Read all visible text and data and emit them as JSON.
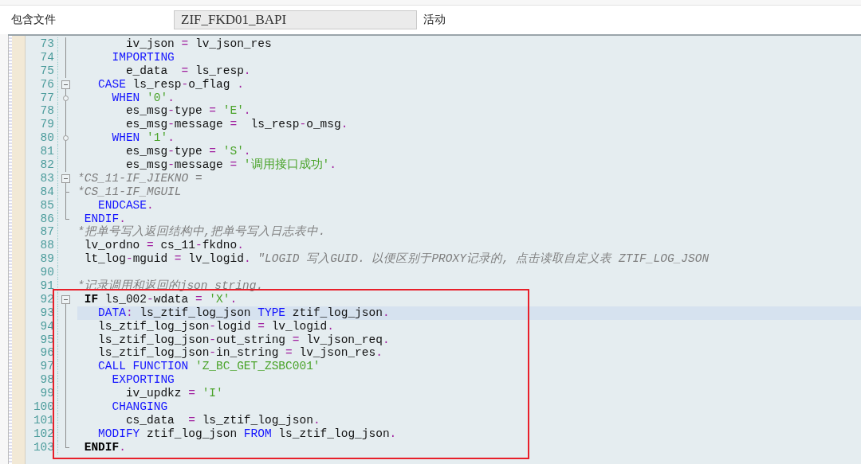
{
  "header": {
    "label": "包含文件",
    "field_value": "ZIF_FKD01_BAPI",
    "status": "活动"
  },
  "lines": [
    {
      "no": "73",
      "kind": "line",
      "current": false,
      "tokens": [
        {
          "kind": "id",
          "text": "       iv_json "
        },
        {
          "kind": "op",
          "text": "="
        },
        {
          "kind": "id",
          "text": " lv_json_res"
        }
      ]
    },
    {
      "no": "74",
      "kind": "line",
      "current": false,
      "tokens": [
        {
          "kind": "kw",
          "text": "     IMPORTING"
        }
      ]
    },
    {
      "no": "75",
      "kind": "line",
      "current": false,
      "tokens": [
        {
          "kind": "id",
          "text": "       e_data  "
        },
        {
          "kind": "op",
          "text": "="
        },
        {
          "kind": "id",
          "text": " ls_resp"
        },
        {
          "kind": "op",
          "text": "."
        }
      ]
    },
    {
      "no": "76",
      "kind": "open",
      "current": false,
      "tokens": [
        {
          "kind": "kw",
          "text": "   CASE"
        },
        {
          "kind": "id",
          "text": " ls_resp"
        },
        {
          "kind": "op",
          "text": "-"
        },
        {
          "kind": "id",
          "text": "o_flag "
        },
        {
          "kind": "op",
          "text": "."
        }
      ]
    },
    {
      "no": "77",
      "kind": "branch",
      "current": false,
      "tokens": [
        {
          "kind": "kw",
          "text": "     WHEN"
        },
        {
          "kind": "str",
          "text": " '0'"
        },
        {
          "kind": "op",
          "text": "."
        }
      ]
    },
    {
      "no": "78",
      "kind": "line",
      "current": false,
      "tokens": [
        {
          "kind": "id",
          "text": "       es_msg"
        },
        {
          "kind": "op",
          "text": "-"
        },
        {
          "kind": "id",
          "text": "type "
        },
        {
          "kind": "op",
          "text": "="
        },
        {
          "kind": "str",
          "text": " 'E'"
        },
        {
          "kind": "op",
          "text": "."
        }
      ]
    },
    {
      "no": "79",
      "kind": "line",
      "current": false,
      "tokens": [
        {
          "kind": "id",
          "text": "       es_msg"
        },
        {
          "kind": "op",
          "text": "-"
        },
        {
          "kind": "id",
          "text": "message "
        },
        {
          "kind": "op",
          "text": "="
        },
        {
          "kind": "id",
          "text": "  ls_resp"
        },
        {
          "kind": "op",
          "text": "-"
        },
        {
          "kind": "id",
          "text": "o_msg"
        },
        {
          "kind": "op",
          "text": "."
        }
      ]
    },
    {
      "no": "80",
      "kind": "branch",
      "current": false,
      "tokens": [
        {
          "kind": "kw",
          "text": "     WHEN"
        },
        {
          "kind": "str",
          "text": " '1'"
        },
        {
          "kind": "op",
          "text": "."
        }
      ]
    },
    {
      "no": "81",
      "kind": "line",
      "current": false,
      "tokens": [
        {
          "kind": "id",
          "text": "       es_msg"
        },
        {
          "kind": "op",
          "text": "-"
        },
        {
          "kind": "id",
          "text": "type "
        },
        {
          "kind": "op",
          "text": "="
        },
        {
          "kind": "str",
          "text": " 'S'"
        },
        {
          "kind": "op",
          "text": "."
        }
      ]
    },
    {
      "no": "82",
      "kind": "line",
      "current": false,
      "tokens": [
        {
          "kind": "id",
          "text": "       es_msg"
        },
        {
          "kind": "op",
          "text": "-"
        },
        {
          "kind": "id",
          "text": "message "
        },
        {
          "kind": "op",
          "text": "="
        },
        {
          "kind": "str",
          "text": " '调用接口成功'"
        },
        {
          "kind": "op",
          "text": "."
        }
      ]
    },
    {
      "no": "83",
      "kind": "open",
      "current": false,
      "tokens": [
        {
          "kind": "cmt",
          "text": "*CS_11-IF_JIEKNO ="
        }
      ]
    },
    {
      "no": "84",
      "kind": "tick",
      "current": false,
      "tokens": [
        {
          "kind": "cmt",
          "text": "*CS_11-IF_MGUIL"
        }
      ]
    },
    {
      "no": "85",
      "kind": "line",
      "current": false,
      "tokens": [
        {
          "kind": "kw",
          "text": "   ENDCASE"
        },
        {
          "kind": "op",
          "text": "."
        }
      ]
    },
    {
      "no": "86",
      "kind": "end",
      "current": false,
      "tokens": [
        {
          "kind": "kw",
          "text": " ENDIF"
        },
        {
          "kind": "op",
          "text": "."
        }
      ]
    },
    {
      "no": "87",
      "kind": "plain",
      "current": false,
      "tokens": [
        {
          "kind": "cmt",
          "text": "*把单号写入返回结构中,把单号写入日志表中."
        }
      ]
    },
    {
      "no": "88",
      "kind": "plain",
      "current": false,
      "tokens": [
        {
          "kind": "id",
          "text": " lv_ordno "
        },
        {
          "kind": "op",
          "text": "="
        },
        {
          "kind": "id",
          "text": " cs_11"
        },
        {
          "kind": "op",
          "text": "-"
        },
        {
          "kind": "id",
          "text": "fkdno"
        },
        {
          "kind": "op",
          "text": "."
        }
      ]
    },
    {
      "no": "89",
      "kind": "plain",
      "current": false,
      "tokens": [
        {
          "kind": "id",
          "text": " lt_log"
        },
        {
          "kind": "op",
          "text": "-"
        },
        {
          "kind": "id",
          "text": "mguid "
        },
        {
          "kind": "op",
          "text": "="
        },
        {
          "kind": "id",
          "text": " lv_logid"
        },
        {
          "kind": "op",
          "text": "."
        },
        {
          "kind": "cmt",
          "text": " \"LOGID 写入GUID. 以便区别于PROXY记录的, 点击读取自定义表 ZTIF_LOG_JSON"
        }
      ]
    },
    {
      "no": "90",
      "kind": "plain",
      "current": false
    },
    {
      "no": "91",
      "kind": "plain",
      "current": false,
      "tokens": [
        {
          "kind": "cmt",
          "text": "*记录调用和返回的json string."
        }
      ]
    },
    {
      "no": "92",
      "kind": "open",
      "current": false,
      "tokens": [
        {
          "kind": "kwb",
          "text": " IF"
        },
        {
          "kind": "id",
          "text": " ls_002"
        },
        {
          "kind": "op",
          "text": "-"
        },
        {
          "kind": "id",
          "text": "wdata "
        },
        {
          "kind": "op",
          "text": "="
        },
        {
          "kind": "str",
          "text": " 'X'"
        },
        {
          "kind": "op",
          "text": "."
        }
      ]
    },
    {
      "no": "93",
      "kind": "line",
      "current": true,
      "tokens": [
        {
          "kind": "kw",
          "text": "   DATA"
        },
        {
          "kind": "op",
          "text": ":"
        },
        {
          "kind": "id",
          "text": " ls_ztif_log_json "
        },
        {
          "kind": "kw",
          "text": "TYPE"
        },
        {
          "kind": "id",
          "text": " ztif_log_json"
        },
        {
          "kind": "op",
          "text": "."
        }
      ]
    },
    {
      "no": "94",
      "kind": "line",
      "current": false,
      "tokens": [
        {
          "kind": "id",
          "text": "   ls_ztif_log_json"
        },
        {
          "kind": "op",
          "text": "-"
        },
        {
          "kind": "id",
          "text": "logid "
        },
        {
          "kind": "op",
          "text": "="
        },
        {
          "kind": "id",
          "text": " lv_logid"
        },
        {
          "kind": "op",
          "text": "."
        }
      ]
    },
    {
      "no": "95",
      "kind": "line",
      "current": false,
      "tokens": [
        {
          "kind": "id",
          "text": "   ls_ztif_log_json"
        },
        {
          "kind": "op",
          "text": "-"
        },
        {
          "kind": "id",
          "text": "out_string "
        },
        {
          "kind": "op",
          "text": "="
        },
        {
          "kind": "id",
          "text": " lv_json_req"
        },
        {
          "kind": "op",
          "text": "."
        }
      ]
    },
    {
      "no": "96",
      "kind": "line",
      "current": false,
      "tokens": [
        {
          "kind": "id",
          "text": "   ls_ztif_log_json"
        },
        {
          "kind": "op",
          "text": "-"
        },
        {
          "kind": "id",
          "text": "in_string "
        },
        {
          "kind": "op",
          "text": "="
        },
        {
          "kind": "id",
          "text": " lv_json_res"
        },
        {
          "kind": "op",
          "text": "."
        }
      ]
    },
    {
      "no": "97",
      "kind": "line",
      "current": false,
      "tokens": [
        {
          "kind": "kw",
          "text": "   CALL FUNCTION"
        },
        {
          "kind": "str",
          "text": " 'Z_BC_GET_ZSBC001'"
        }
      ]
    },
    {
      "no": "98",
      "kind": "line",
      "current": false,
      "tokens": [
        {
          "kind": "kw",
          "text": "     EXPORTING"
        }
      ]
    },
    {
      "no": "99",
      "kind": "line",
      "current": false,
      "tokens": [
        {
          "kind": "id",
          "text": "       iv_updkz "
        },
        {
          "kind": "op",
          "text": "="
        },
        {
          "kind": "str",
          "text": " 'I'"
        }
      ]
    },
    {
      "no": "100",
      "kind": "line",
      "current": false,
      "tokens": [
        {
          "kind": "kw",
          "text": "     CHANGING"
        }
      ]
    },
    {
      "no": "101",
      "kind": "line",
      "current": false,
      "tokens": [
        {
          "kind": "id",
          "text": "       cs_data  "
        },
        {
          "kind": "op",
          "text": "="
        },
        {
          "kind": "id",
          "text": " ls_ztif_log_json"
        },
        {
          "kind": "op",
          "text": "."
        }
      ]
    },
    {
      "no": "102",
      "kind": "line",
      "current": false,
      "tokens": [
        {
          "kind": "kw",
          "text": "   MODIFY"
        },
        {
          "kind": "id",
          "text": " ztif_log_json "
        },
        {
          "kind": "kw",
          "text": "FROM"
        },
        {
          "kind": "id",
          "text": " ls_ztif_log_json"
        },
        {
          "kind": "op",
          "text": "."
        }
      ]
    },
    {
      "no": "103",
      "kind": "end",
      "current": false,
      "tokens": [
        {
          "kind": "kwb",
          "text": " ENDIF"
        },
        {
          "kind": "op",
          "text": "."
        }
      ]
    }
  ]
}
